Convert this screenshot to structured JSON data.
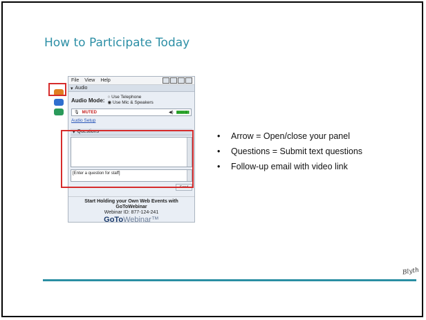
{
  "slide": {
    "title": "How to Participate Today",
    "bullets": [
      "Arrow = Open/close your panel",
      "Questions = Submit text questions",
      "Follow-up email with video link"
    ],
    "logo_text": "Blyth"
  },
  "panel": {
    "menu": [
      "File",
      "View",
      "Help"
    ],
    "audio_section": "Audio",
    "audio_mode_label": "Audio Mode:",
    "radio_options": [
      "Use Telephone",
      "Use Mic & Speakers"
    ],
    "muted_label": "MUTED",
    "audio_setup": "Audio Setup",
    "questions_section": "Questions",
    "question_placeholder": "[Enter a question for staff]",
    "send": "Send",
    "promo_line1": "Start Holding your Own Web Events with",
    "promo_line2": "GoToWebinar",
    "promo_line3": "Webinar ID: 877-124-241",
    "brand_bold": "GoTo",
    "brand_light": "Webinar™"
  },
  "colors": {
    "title": "#2d8fa6",
    "rule": "#2a8ea3",
    "highlight": "#d62b2b"
  }
}
